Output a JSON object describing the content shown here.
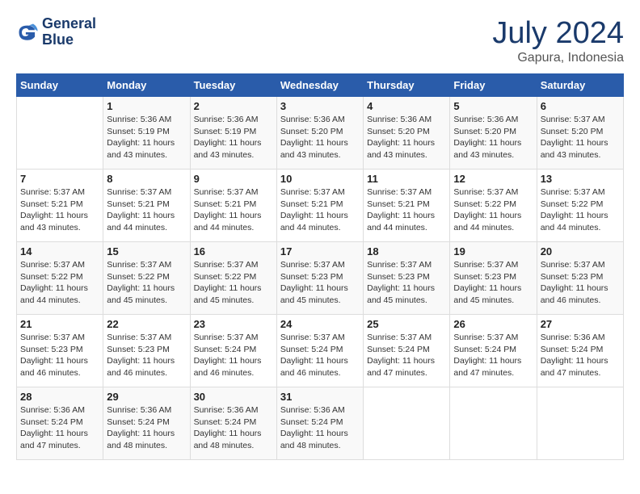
{
  "header": {
    "logo_line1": "General",
    "logo_line2": "Blue",
    "month": "July 2024",
    "location": "Gapura, Indonesia"
  },
  "columns": [
    "Sunday",
    "Monday",
    "Tuesday",
    "Wednesday",
    "Thursday",
    "Friday",
    "Saturday"
  ],
  "weeks": [
    [
      {
        "day": "",
        "info": ""
      },
      {
        "day": "1",
        "info": "Sunrise: 5:36 AM\nSunset: 5:19 PM\nDaylight: 11 hours\nand 43 minutes."
      },
      {
        "day": "2",
        "info": "Sunrise: 5:36 AM\nSunset: 5:19 PM\nDaylight: 11 hours\nand 43 minutes."
      },
      {
        "day": "3",
        "info": "Sunrise: 5:36 AM\nSunset: 5:20 PM\nDaylight: 11 hours\nand 43 minutes."
      },
      {
        "day": "4",
        "info": "Sunrise: 5:36 AM\nSunset: 5:20 PM\nDaylight: 11 hours\nand 43 minutes."
      },
      {
        "day": "5",
        "info": "Sunrise: 5:36 AM\nSunset: 5:20 PM\nDaylight: 11 hours\nand 43 minutes."
      },
      {
        "day": "6",
        "info": "Sunrise: 5:37 AM\nSunset: 5:20 PM\nDaylight: 11 hours\nand 43 minutes."
      }
    ],
    [
      {
        "day": "7",
        "info": "Sunrise: 5:37 AM\nSunset: 5:21 PM\nDaylight: 11 hours\nand 43 minutes."
      },
      {
        "day": "8",
        "info": "Sunrise: 5:37 AM\nSunset: 5:21 PM\nDaylight: 11 hours\nand 44 minutes."
      },
      {
        "day": "9",
        "info": "Sunrise: 5:37 AM\nSunset: 5:21 PM\nDaylight: 11 hours\nand 44 minutes."
      },
      {
        "day": "10",
        "info": "Sunrise: 5:37 AM\nSunset: 5:21 PM\nDaylight: 11 hours\nand 44 minutes."
      },
      {
        "day": "11",
        "info": "Sunrise: 5:37 AM\nSunset: 5:21 PM\nDaylight: 11 hours\nand 44 minutes."
      },
      {
        "day": "12",
        "info": "Sunrise: 5:37 AM\nSunset: 5:22 PM\nDaylight: 11 hours\nand 44 minutes."
      },
      {
        "day": "13",
        "info": "Sunrise: 5:37 AM\nSunset: 5:22 PM\nDaylight: 11 hours\nand 44 minutes."
      }
    ],
    [
      {
        "day": "14",
        "info": "Sunrise: 5:37 AM\nSunset: 5:22 PM\nDaylight: 11 hours\nand 44 minutes."
      },
      {
        "day": "15",
        "info": "Sunrise: 5:37 AM\nSunset: 5:22 PM\nDaylight: 11 hours\nand 45 minutes."
      },
      {
        "day": "16",
        "info": "Sunrise: 5:37 AM\nSunset: 5:22 PM\nDaylight: 11 hours\nand 45 minutes."
      },
      {
        "day": "17",
        "info": "Sunrise: 5:37 AM\nSunset: 5:23 PM\nDaylight: 11 hours\nand 45 minutes."
      },
      {
        "day": "18",
        "info": "Sunrise: 5:37 AM\nSunset: 5:23 PM\nDaylight: 11 hours\nand 45 minutes."
      },
      {
        "day": "19",
        "info": "Sunrise: 5:37 AM\nSunset: 5:23 PM\nDaylight: 11 hours\nand 45 minutes."
      },
      {
        "day": "20",
        "info": "Sunrise: 5:37 AM\nSunset: 5:23 PM\nDaylight: 11 hours\nand 46 minutes."
      }
    ],
    [
      {
        "day": "21",
        "info": "Sunrise: 5:37 AM\nSunset: 5:23 PM\nDaylight: 11 hours\nand 46 minutes."
      },
      {
        "day": "22",
        "info": "Sunrise: 5:37 AM\nSunset: 5:23 PM\nDaylight: 11 hours\nand 46 minutes."
      },
      {
        "day": "23",
        "info": "Sunrise: 5:37 AM\nSunset: 5:24 PM\nDaylight: 11 hours\nand 46 minutes."
      },
      {
        "day": "24",
        "info": "Sunrise: 5:37 AM\nSunset: 5:24 PM\nDaylight: 11 hours\nand 46 minutes."
      },
      {
        "day": "25",
        "info": "Sunrise: 5:37 AM\nSunset: 5:24 PM\nDaylight: 11 hours\nand 47 minutes."
      },
      {
        "day": "26",
        "info": "Sunrise: 5:37 AM\nSunset: 5:24 PM\nDaylight: 11 hours\nand 47 minutes."
      },
      {
        "day": "27",
        "info": "Sunrise: 5:36 AM\nSunset: 5:24 PM\nDaylight: 11 hours\nand 47 minutes."
      }
    ],
    [
      {
        "day": "28",
        "info": "Sunrise: 5:36 AM\nSunset: 5:24 PM\nDaylight: 11 hours\nand 47 minutes."
      },
      {
        "day": "29",
        "info": "Sunrise: 5:36 AM\nSunset: 5:24 PM\nDaylight: 11 hours\nand 48 minutes."
      },
      {
        "day": "30",
        "info": "Sunrise: 5:36 AM\nSunset: 5:24 PM\nDaylight: 11 hours\nand 48 minutes."
      },
      {
        "day": "31",
        "info": "Sunrise: 5:36 AM\nSunset: 5:24 PM\nDaylight: 11 hours\nand 48 minutes."
      },
      {
        "day": "",
        "info": ""
      },
      {
        "day": "",
        "info": ""
      },
      {
        "day": "",
        "info": ""
      }
    ]
  ]
}
